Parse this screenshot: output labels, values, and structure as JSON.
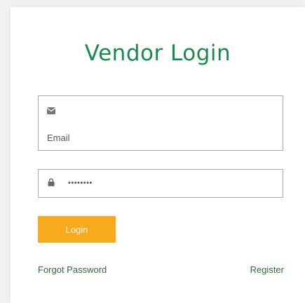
{
  "login_form": {
    "title": "Vendor Login",
    "email": {
      "icon": "envelope-icon",
      "placeholder": "Email",
      "value": ""
    },
    "password": {
      "icon": "lock-icon",
      "value": "password"
    },
    "login_button_label": "Login",
    "forgot_password_label": "Forgot Password",
    "register_label": "Register"
  },
  "colors": {
    "title": "#1a8a4a",
    "button_bg": "#f7ab1a",
    "button_text": "#ffffff",
    "link": "#2f6b3b",
    "field_border": "#aaaaaa",
    "background": "#f1f1f1"
  }
}
